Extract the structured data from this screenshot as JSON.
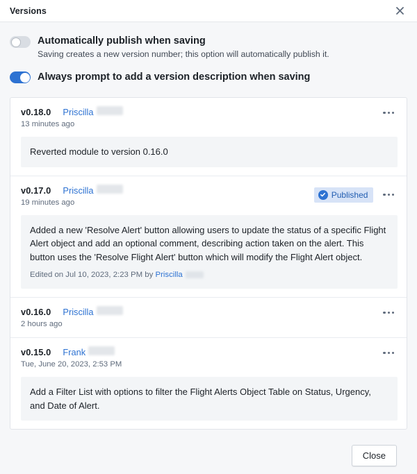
{
  "dialog": {
    "title": "Versions",
    "close_icon": "close-icon"
  },
  "settings": [
    {
      "label": "Automatically publish when saving",
      "description": "Saving creates a new version number; this option will automatically publish it.",
      "enabled": false
    },
    {
      "label": "Always prompt to add a version description when saving",
      "description": "",
      "enabled": true
    }
  ],
  "versions": [
    {
      "version": "v0.18.0",
      "author": "Priscilla",
      "timestamp": "13 minutes ago",
      "published": false,
      "badge_label": "",
      "description": "Reverted module to version 0.16.0",
      "edited_prefix": "",
      "edited_author": ""
    },
    {
      "version": "v0.17.0",
      "author": "Priscilla",
      "timestamp": "19 minutes ago",
      "published": true,
      "badge_label": "Published",
      "description": "Added a new 'Resolve Alert' button allowing users to update the status of a specific Flight Alert object and add an optional comment, describing action taken on the alert. This button uses the 'Resolve Flight Alert' button which will modify the Flight Alert object.",
      "edited_prefix": "Edited on Jul 10, 2023, 2:23 PM by ",
      "edited_author": "Priscilla"
    },
    {
      "version": "v0.16.0",
      "author": "Priscilla",
      "timestamp": "2 hours ago",
      "published": false,
      "badge_label": "",
      "description": "",
      "edited_prefix": "",
      "edited_author": ""
    },
    {
      "version": "v0.15.0",
      "author": "Frank",
      "timestamp": "Tue, June 20, 2023, 2:53 PM",
      "published": false,
      "badge_label": "",
      "description": "Add a Filter List with options to filter the Flight Alerts Object Table on Status, Urgency, and Date of Alert.",
      "edited_prefix": "",
      "edited_author": ""
    }
  ],
  "footer": {
    "close_label": "Close"
  },
  "colors": {
    "accent": "#2d72d2",
    "badge_bg": "#d7e3f7",
    "badge_text": "#215db0",
    "page_bg": "#f6f7f9",
    "card_bg": "#ffffff",
    "desc_bg": "#f3f5f7",
    "muted_text": "#5f6b7c"
  }
}
